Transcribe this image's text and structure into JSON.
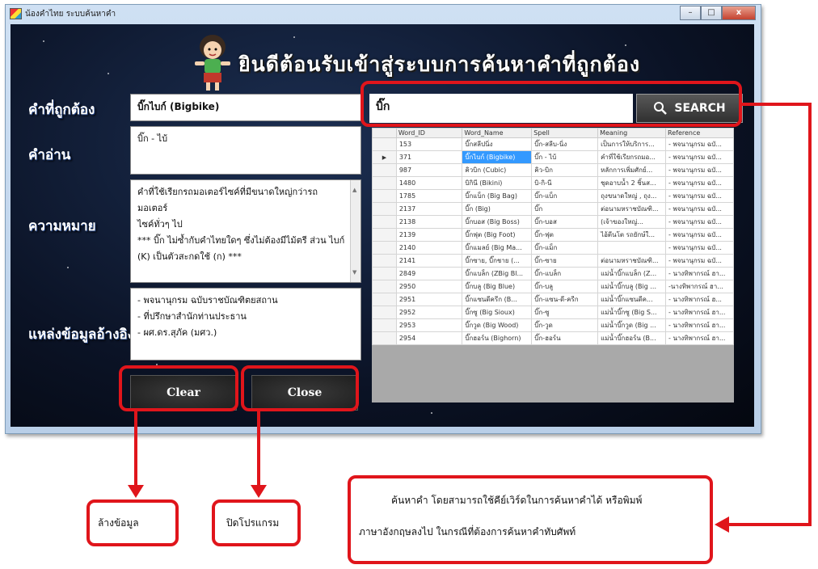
{
  "window": {
    "title": "น้องคำไทย ระบบค้นหาคำ",
    "buttons": {
      "minimize": "–",
      "maximize": "□",
      "close": "x"
    }
  },
  "header": {
    "title": "ยินดีต้อนรับเข้าสู่ระบบการค้นหาคำที่ถูกต้อง"
  },
  "labels": {
    "correct_word": "คำที่ถูกต้อง",
    "reading": "คำอ่าน",
    "meaning": "ความหมาย",
    "reference": "แหล่งข้อมูลอ้างอิง"
  },
  "details": {
    "correct_word": "บิ๊กไบก์ (Bigbike)",
    "reading": "บิ๊ก - ไบ้",
    "meaning_lines": [
      "คำที่ใช้เรียกรถมอเตอร์ไซค์ที่มีขนาดใหญ่กว่ารถมอเตอร์",
      "ไซค์ทั่วๆ ไป",
      "*** บิ๊ก ไม่ซ้ำกับคำไทยใดๆ ซึ่งไม่ต้องมีไม้ตรี ส่วน ไบก์",
      "(K) เป็นตัวสะกดใช้ (ก) ***"
    ],
    "reference_lines": [
      "- พจนานุกรม ฉบับราชบัณฑิตยสถาน",
      "- ที่ปรึกษาสำนักท่านประธาน",
      "- ผศ.ดร.สุภัค (มศว.)"
    ]
  },
  "buttons": {
    "clear": "Clear",
    "close": "Close"
  },
  "search": {
    "value": "บิ๊ก",
    "button_label": "SEARCH"
  },
  "grid": {
    "columns": [
      "Word_ID",
      "Word_Name",
      "Spell",
      "Meaning",
      "Reference"
    ],
    "rows": [
      [
        "153",
        "บิ๊กสลีปนิ่ง",
        "บิ๊ก-สลีบ-นิ่ง",
        "เป็นการให้บริการ...",
        "- พจนานุกรม ฉบั..."
      ],
      [
        "371",
        "บิ๊กไบก์ (Bigbike)",
        "บิ๊ก - ไบ้",
        "คำที่ใช้เรียกรถมอ...",
        "- พจนานุกรม ฉบั..."
      ],
      [
        "987",
        "คิวบิก (Cubic)",
        "คิว-บิก",
        "หลักการเพิ่มศักย์...",
        "- พจนานุกรม ฉบั..."
      ],
      [
        "1480",
        "บิกินี (Bikini)",
        "บิ-กิ-นี",
        "ชุดอาบน้ำ 2 ชิ้นส...",
        "- พจนานุกรม ฉบั..."
      ],
      [
        "1785",
        "บิ๊กแบ็ก (Big Bag)",
        "บิ๊ก-แบ็ก",
        "ถุงขนาดใหญ่ , ถุง...",
        "- พจนานุกรม ฉบั..."
      ],
      [
        "2137",
        "บิ๊ก (Big)",
        "บิ๊ก",
        "ต่อนามหราชบัณฑิ...",
        "- พจนานุกรม ฉบั..."
      ],
      [
        "2138",
        "บิ๊กบอส (Big Boss)",
        "บิ๊ก-บอส",
        "(เจ้าของใหญ่...",
        "- พจนานุกรม ฉบั..."
      ],
      [
        "2139",
        "บิ๊กฟุต (Big Foot)",
        "บิ๊ก-ฟุต",
        "ไอ้ตีนโต รถยักษ์ใ...",
        "- พจนานุกรม ฉบั..."
      ],
      [
        "2140",
        "บิ๊กแมลย์ (Big Ma...",
        "บิ๊ก-แม็ก",
        "",
        "- พจนานุกรม ฉบั..."
      ],
      [
        "2141",
        "บิ๊กซาย, บิ๊กชาย (...",
        "บิ๊ก-ซาย",
        "ต่อนามหราชบัณฑิ...",
        "- พจนานุกรม ฉบั..."
      ],
      [
        "2849",
        "บิ๊กแบล็ก (ZBig Bl...",
        "บิ๊ก-แบล็ก",
        "แม่น้ำบิ๊กแบล็ก (Z...",
        "- นางทิพากรณ์ ฮา..."
      ],
      [
        "2950",
        "บิ๊กบลู (Big Blue)",
        "บิ๊ก-บลู",
        "แม่น้ำบิ๊กบลู (Big ...",
        "-นางทิพากรณ์ ฮา..."
      ],
      [
        "2951",
        "บิ๊กแซนดีครีก (B...",
        "บิ๊ก-แซน-ดี-ครีก",
        "แม่น้ำบิ๊กแซนดีค...",
        "- นางทิพากรณ์ ฮ..."
      ],
      [
        "2952",
        "บิ๊กซู (Big Sioux)",
        "บิ๊ก-ซู",
        "แม่น้ำบิ๊กซู (Big S...",
        "- นางทิพากรณ์ ฮา..."
      ],
      [
        "2953",
        "บิ๊กวูด (Big Wood)",
        "บิ๊ก-วูด",
        "แม่น้ำบิ๊กวูด (Big ...",
        "- นางทิพากรณ์ ฮา..."
      ],
      [
        "2954",
        "บิ๊กฮอร์น (Bighorn)",
        "บิ๊ก-ฮอร์น",
        "แม่น้ำบิ๊กฮอร์น (B...",
        "- นางทิพากรณ์ ฮา..."
      ]
    ],
    "selected_row_index": 1
  },
  "annotations": {
    "clear_caption": "ล้างข้อมูล",
    "close_caption": "ปิดโปรแกรม",
    "search_note_line1": "ค้นหาคำ โดยสามารถใช้คีย์เวิร์ดในการค้นหาคำได้ หรือพิมพ์",
    "search_note_line2": "ภาษาอังกฤษลงไป ในกรณีที่ต้องการค้นหาคำทับศัพท์"
  },
  "colors": {
    "highlight_red": "#e0151b",
    "selected_row": "#3399ff",
    "background_dark": "#0b1326"
  }
}
